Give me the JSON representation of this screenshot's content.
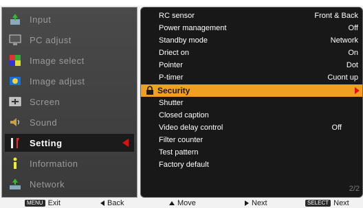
{
  "colors": {
    "accent": "#f0a020",
    "arrow": "#e01010",
    "panel": "#181818",
    "menu": "#3f3f3f"
  },
  "left_menu": {
    "items": [
      {
        "label": "Input",
        "icon": "input-icon"
      },
      {
        "label": "PC adjust",
        "icon": "pc-adjust-icon"
      },
      {
        "label": "Image select",
        "icon": "image-select-icon"
      },
      {
        "label": "Image adjust",
        "icon": "image-adjust-icon"
      },
      {
        "label": "Screen",
        "icon": "screen-icon"
      },
      {
        "label": "Sound",
        "icon": "sound-icon"
      },
      {
        "label": "Setting",
        "icon": "setting-icon",
        "active": true
      },
      {
        "label": "Information",
        "icon": "information-icon"
      },
      {
        "label": "Network",
        "icon": "network-icon"
      }
    ]
  },
  "setting_menu": {
    "rows": [
      {
        "name": "RC sensor",
        "value": "Front & Back"
      },
      {
        "name": "Power management",
        "value": "Off"
      },
      {
        "name": "Standby mode",
        "value": "Network"
      },
      {
        "name": "Driect on",
        "value": "On"
      },
      {
        "name": "Pointer",
        "value": "Dot"
      },
      {
        "name": "P-timer",
        "value": "Cuont up"
      },
      {
        "name": "Security",
        "value": "",
        "highlighted": true
      },
      {
        "name": "Shutter",
        "value": ""
      },
      {
        "name": "Closed caption",
        "value": ""
      },
      {
        "name": "Video delay control",
        "value": "Off"
      },
      {
        "name": "Filter counter",
        "value": ""
      },
      {
        "name": "Test pattern",
        "value": ""
      },
      {
        "name": "Factory default",
        "value": ""
      }
    ],
    "page_indicator": "2/2"
  },
  "help_bar": {
    "exit_key": "MENU",
    "exit_label": "Exit",
    "back_label": "Back",
    "move_label": "Move",
    "next_label": "Next",
    "select_key": "SELECT",
    "select_next_label": "Next"
  }
}
